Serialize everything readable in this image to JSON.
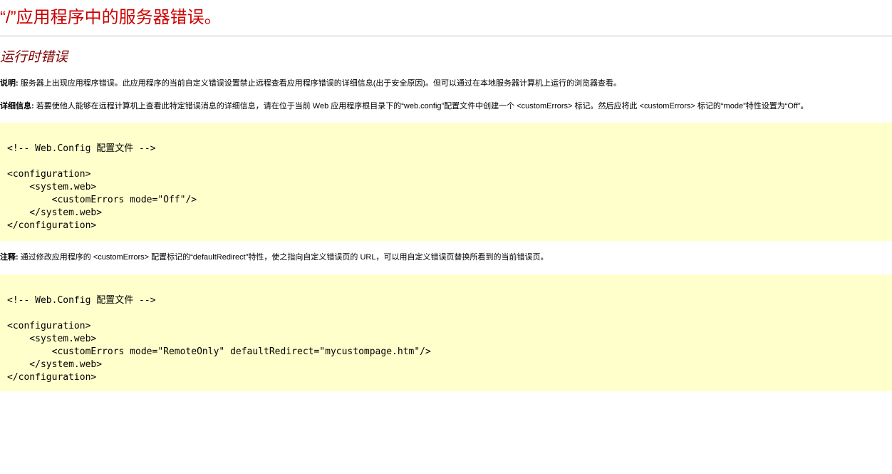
{
  "page": {
    "title": "“/”应用程序中的服务器错误。",
    "section_heading": "运行时错误"
  },
  "description": {
    "label": "说明:",
    "text": " 服务器上出现应用程序错误。此应用程序的当前自定义错误设置禁止远程查看应用程序错误的详细信息(出于安全原因)。但可以通过在本地服务器计算机上运行的浏览器查看。"
  },
  "details": {
    "label": "详细信息:",
    "text": " 若要使他人能够在远程计算机上查看此特定错误消息的详细信息，请在位于当前 Web 应用程序根目录下的“web.config”配置文件中创建一个 <customErrors> 标记。然后应将此 <customErrors> 标记的“mode”特性设置为“Off”。"
  },
  "code_block_1": {
    "lines": [
      "<!-- Web.Config 配置文件 -->",
      "",
      "<configuration>",
      "    <system.web>",
      "        <customErrors mode=\"Off\"/>",
      "    </system.web>",
      "</configuration>"
    ]
  },
  "note": {
    "label": "注释:",
    "text": " 通过修改应用程序的 <customErrors> 配置标记的“defaultRedirect”特性，使之指向自定义错误页的 URL，可以用自定义错误页替换所看到的当前错误页。"
  },
  "code_block_2": {
    "lines": [
      "<!-- Web.Config 配置文件 -->",
      "",
      "<configuration>",
      "    <system.web>",
      "        <customErrors mode=\"RemoteOnly\" defaultRedirect=\"mycustompage.htm\"/>",
      "    </system.web>",
      "</configuration>"
    ]
  },
  "colors": {
    "title": "#cc0000",
    "section_heading": "#800000",
    "code_background": "#ffffcc",
    "rule": "#c0c0c0"
  }
}
